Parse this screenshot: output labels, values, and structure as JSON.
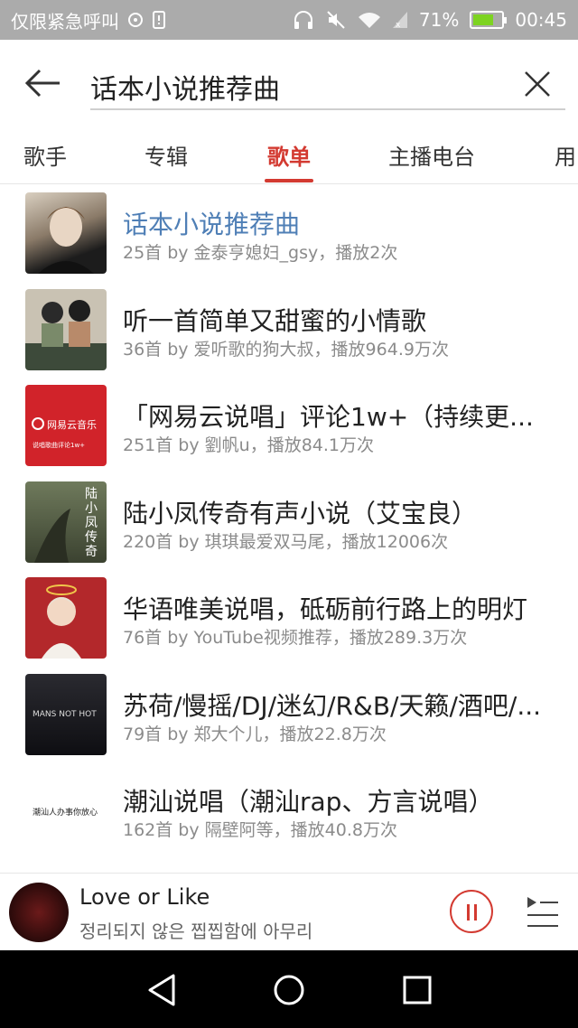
{
  "status_bar": {
    "carrier": "仅限紧急呼叫",
    "battery_percent": "71%",
    "battery_level": 0.71,
    "time": "00:45"
  },
  "search": {
    "query": "话本小说推荐曲"
  },
  "tabs": [
    {
      "label": "歌手"
    },
    {
      "label": "专辑"
    },
    {
      "label": "歌单",
      "active": true
    },
    {
      "label": "主播电台"
    },
    {
      "label": "用"
    }
  ],
  "playlists": [
    {
      "title": "话本小说推荐曲",
      "subtitle": "25首  by 金泰亨媳妇_gsy，播放2次"
    },
    {
      "title": "听一首简单又甜蜜的小情歌",
      "subtitle": "36首  by 爱听歌的狗大叔，播放964.9万次"
    },
    {
      "title": "「网易云说唱」评论1w+（持续更...",
      "subtitle": "251首  by 劉帆u，播放84.1万次",
      "thumb_text": "网易云音乐",
      "thumb_caption": "说唱歌曲评论1w+"
    },
    {
      "title": "陆小凤传奇有声小说（艾宝良）",
      "subtitle": "220首  by 琪琪最爱双马尾，播放12006次",
      "thumb_text": "陆小凤传奇"
    },
    {
      "title": "华语唯美说唱，砥砺前行路上的明灯",
      "subtitle": "76首  by YouTube视频推荐，播放289.3万次"
    },
    {
      "title": "苏荷/慢摇/DJ/迷幻/R&B/天籁/酒吧/...",
      "subtitle": "79首  by 郑大个儿，播放22.8万次",
      "thumb_text": "MANS NOT HOT"
    },
    {
      "title": "潮汕说唱（潮汕rap、方言说唱）",
      "subtitle": "162首  by 隔壁阿等，播放40.8万次",
      "thumb_text": "潮汕人办事你放心"
    }
  ],
  "player": {
    "title": "Love or Like",
    "subtitle": "정리되지 않은 찝찝함에 아무리"
  },
  "colors": {
    "accent": "#d33a31",
    "highlight": "#4f7fb6",
    "status_bar": "#ababab"
  }
}
